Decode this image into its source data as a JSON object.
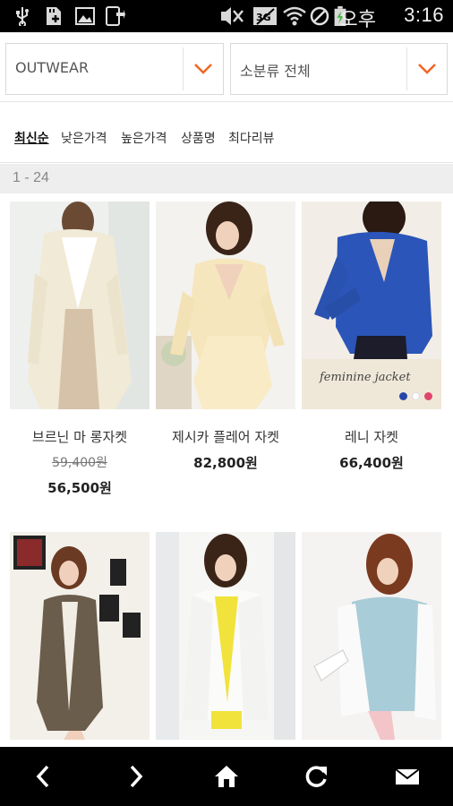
{
  "status_bar": {
    "ampm": "오후",
    "time": "3:16",
    "icons": [
      "usb-icon",
      "sd-card-icon",
      "image-icon",
      "download-icon",
      "mute-icon",
      "data-icon",
      "wifi-icon",
      "no-sign-icon",
      "battery-icon"
    ]
  },
  "filters": {
    "category": {
      "value": "OUTWEAR",
      "icon": "chevron-down-icon"
    },
    "subcategory": {
      "value": "소분류 전체",
      "icon": "chevron-down-icon"
    },
    "accent_color": "#f26522"
  },
  "sort": {
    "items": [
      "최신순",
      "낮은가격",
      "높은가격",
      "상품명",
      "최다리뷰"
    ],
    "active": "최신순"
  },
  "range": {
    "label": "1 - 24"
  },
  "products": [
    {
      "name": "브르닌 마 롱자켓",
      "original_price": "59,400원",
      "price": "56,500원"
    },
    {
      "name": "제시카 플레어 자켓",
      "price": "82,800원"
    },
    {
      "name": "레니 자켓",
      "price": "66,400원",
      "image_caption": "feminine jacket",
      "swatch_colors": [
        "#2747a8",
        "#ffffff",
        "#e0456b"
      ]
    },
    {
      "name": ""
    },
    {
      "name": ""
    },
    {
      "name": ""
    }
  ],
  "nav_bar": {
    "icons": [
      "back-arrow-icon",
      "forward-arrow-icon",
      "home-icon",
      "refresh-icon",
      "mail-icon"
    ]
  }
}
